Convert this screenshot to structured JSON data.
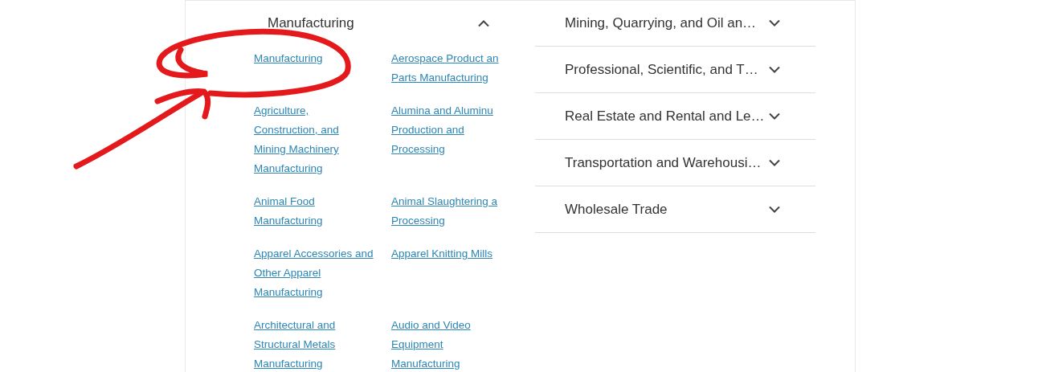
{
  "open_section": {
    "title": "Manufacturing",
    "expanded": true,
    "links": [
      {
        "lines": [
          "Manufacturing"
        ]
      },
      {
        "lines": [
          "Aerospace Product an",
          "Parts Manufacturing"
        ]
      },
      {
        "lines": [
          "Agriculture,",
          "Construction, and",
          "Mining Machinery",
          "Manufacturing"
        ]
      },
      {
        "lines": [
          "Alumina and Aluminu",
          "Production and",
          "Processing"
        ]
      },
      {
        "lines": [
          "Animal Food",
          "Manufacturing"
        ]
      },
      {
        "lines": [
          "Animal Slaughtering a",
          "Processing"
        ]
      },
      {
        "lines": [
          "Apparel Accessories and",
          "Other Apparel",
          "Manufacturing"
        ]
      },
      {
        "lines": [
          "Apparel Knitting Mills"
        ]
      },
      {
        "lines": [
          "Architectural and",
          "Structural Metals",
          "Manufacturing"
        ]
      },
      {
        "lines": [
          "Audio and Video",
          "Equipment",
          "Manufacturing"
        ]
      }
    ]
  },
  "sections": [
    {
      "title": "Mining, Quarrying, and Oil an…",
      "expanded": false
    },
    {
      "title": "Professional, Scientific, and T…",
      "expanded": false
    },
    {
      "title": "Real Estate and Rental and Le…",
      "expanded": false
    },
    {
      "title": "Transportation and Warehousi…",
      "expanded": false
    },
    {
      "title": "Wholesale Trade",
      "expanded": false
    }
  ]
}
